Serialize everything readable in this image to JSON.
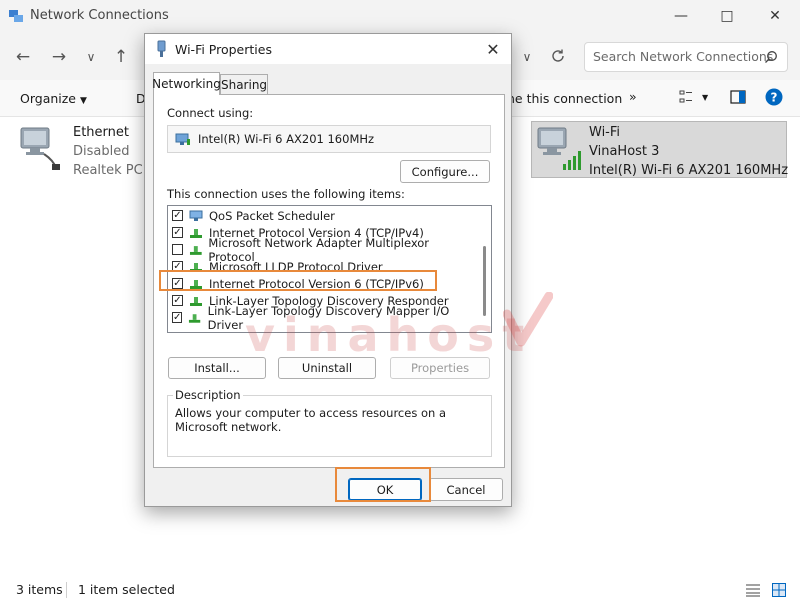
{
  "explorer": {
    "title": "Network Connections",
    "search_placeholder": "Search Network Connections",
    "command_bar": {
      "organize": "Organize",
      "partial_label": "D",
      "rename_label": "ne this connection",
      "more": "»"
    },
    "items": [
      {
        "name": "Ethernet",
        "status": "Disabled",
        "device": "Realtek PCIe C"
      },
      {
        "name": "Wi-Fi",
        "status": "VinaHost 3",
        "device": "Intel(R) Wi-Fi 6 AX201 160MHz",
        "selected": true
      }
    ],
    "status_bar": {
      "count": "3 items",
      "selection": "1 item selected"
    }
  },
  "dialog": {
    "title": "Wi-Fi Properties",
    "tabs": [
      {
        "label": "Networking",
        "active": true
      },
      {
        "label": "Sharing",
        "active": false
      }
    ],
    "connect_using_label": "Connect using:",
    "adapter_name": "Intel(R) Wi-Fi 6 AX201 160MHz",
    "configure_label": "Configure...",
    "items_label": "This connection uses the following items:",
    "list_items": [
      {
        "label": "QoS Packet Scheduler",
        "checked": true,
        "icon": "qos-icon"
      },
      {
        "label": "Internet Protocol Version 4 (TCP/IPv4)",
        "checked": true,
        "icon": "protocol-icon"
      },
      {
        "label": "Microsoft Network Adapter Multiplexor Protocol",
        "checked": false,
        "icon": "protocol-icon"
      },
      {
        "label": "Microsoft LLDP Protocol Driver",
        "checked": true,
        "icon": "protocol-icon"
      },
      {
        "label": "Internet Protocol Version 6 (TCP/IPv6)",
        "checked": true,
        "icon": "protocol-icon",
        "highlighted": true
      },
      {
        "label": "Link-Layer Topology Discovery Responder",
        "checked": true,
        "icon": "protocol-icon"
      },
      {
        "label": "Link-Layer Topology Discovery Mapper I/O Driver",
        "checked": true,
        "icon": "protocol-icon"
      }
    ],
    "install_label": "Install...",
    "uninstall_label": "Uninstall",
    "properties_label": "Properties",
    "description_heading": "Description",
    "description_text": "Allows your computer to access resources on a Microsoft network.",
    "ok_label": "OK",
    "cancel_label": "Cancel"
  },
  "watermark": "vinahost",
  "colors": {
    "highlight": "#e8893b",
    "accent": "#0067c0",
    "selected_tile": "#d9d9d9"
  }
}
